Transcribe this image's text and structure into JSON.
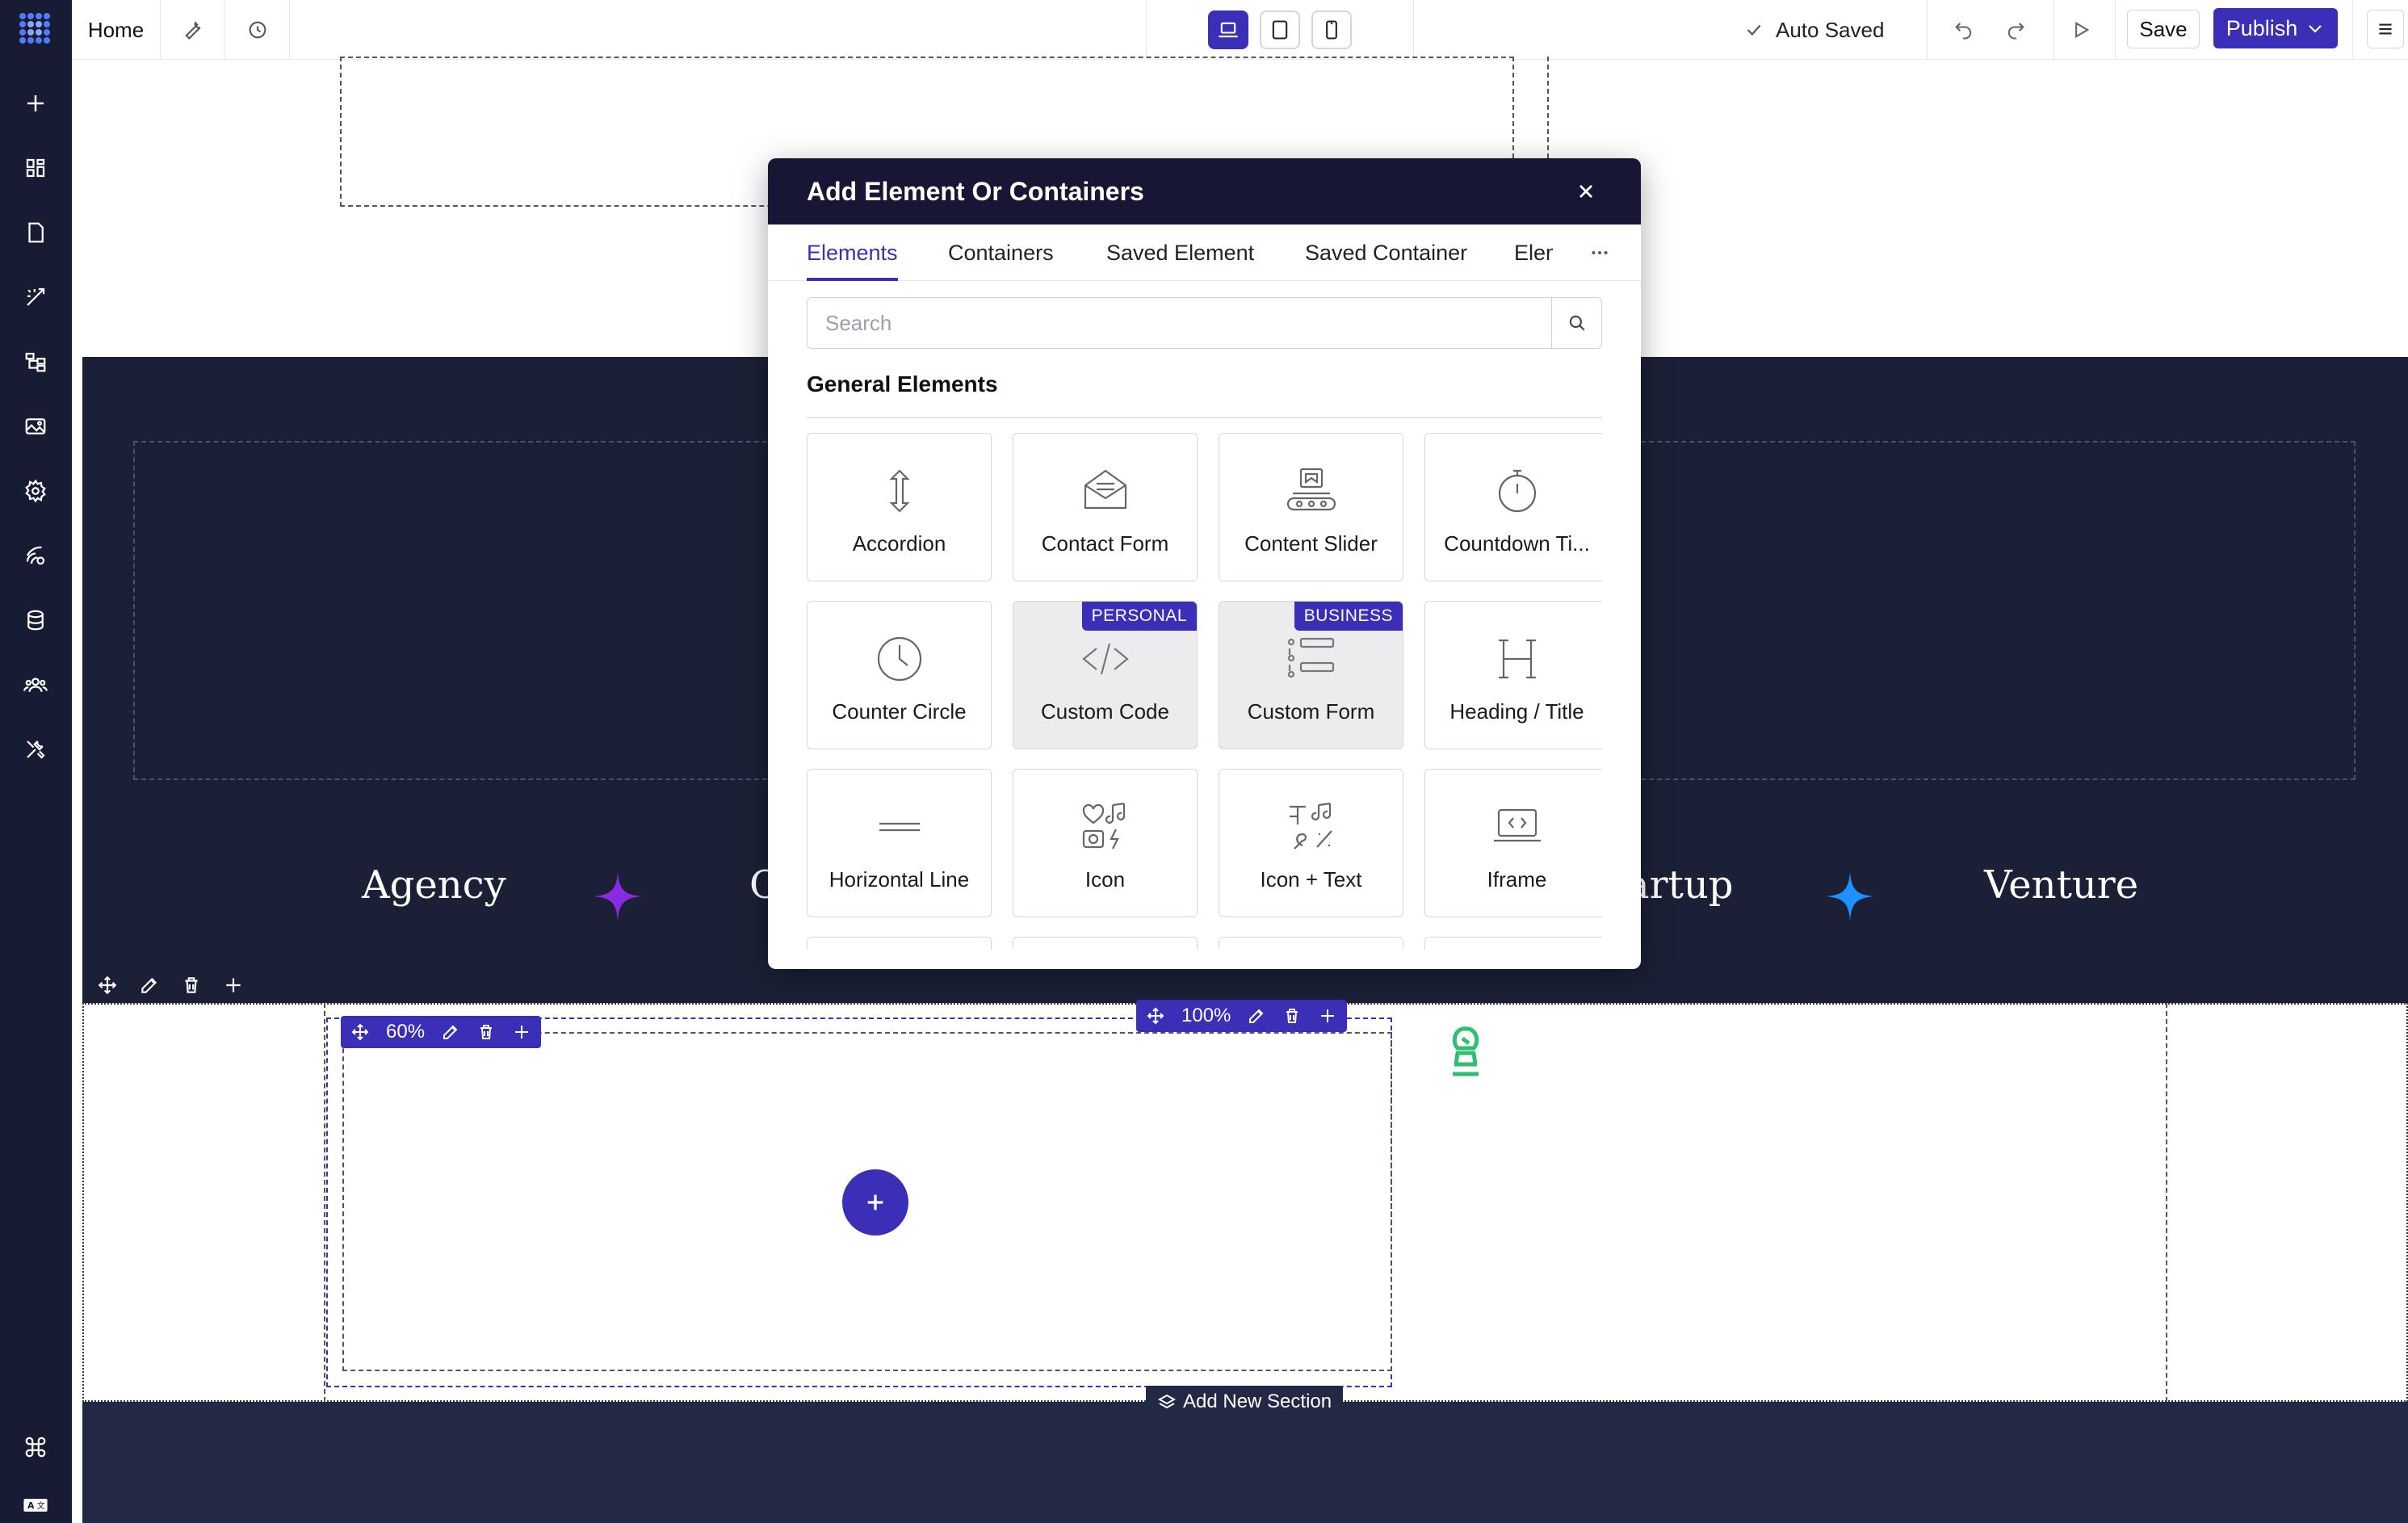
{
  "topbar": {
    "home_label": "Home",
    "autosave_label": "Auto Saved",
    "save_label": "Save",
    "publish_label": "Publish"
  },
  "sidebar": {
    "items": [
      "add-icon",
      "layout-grid-icon",
      "page-icon",
      "magic-icon",
      "structure-icon",
      "image-icon",
      "settings-icon",
      "integrations-icon",
      "database-icon",
      "users-icon",
      "tools-icon",
      "command-icon",
      "language-icon"
    ]
  },
  "canvas": {
    "marquee": [
      "Agency",
      "C",
      "artup",
      "Venture"
    ],
    "column_width": "60%",
    "row_width": "100%",
    "add_section_label": "Add New Section"
  },
  "modal": {
    "title": "Add Element Or Containers",
    "tabs": [
      "Elements",
      "Containers",
      "Saved Element",
      "Saved Container",
      "Eleme"
    ],
    "active_tab": "Elements",
    "search": {
      "placeholder": "Search",
      "value": ""
    },
    "group_title": "General Elements",
    "cards": [
      {
        "label": "Accordion",
        "icon": "accordion-icon"
      },
      {
        "label": "Contact Form",
        "icon": "envelope-icon"
      },
      {
        "label": "Content Slider",
        "icon": "slider-icon"
      },
      {
        "label": "Countdown Ti...",
        "icon": "stopwatch-icon"
      },
      {
        "label": "Counter Circle",
        "icon": "clock-icon"
      },
      {
        "label": "Custom Code",
        "icon": "code-icon",
        "badge": "PERSONAL"
      },
      {
        "label": "Custom Form",
        "icon": "form-icon",
        "badge": "BUSINESS"
      },
      {
        "label": "Heading / Title",
        "icon": "heading-icon"
      },
      {
        "label": "Horizontal Line",
        "icon": "line-icon"
      },
      {
        "label": "Icon",
        "icon": "icons-icon"
      },
      {
        "label": "Icon + Text",
        "icon": "icon-text-icon"
      },
      {
        "label": "Iframe",
        "icon": "iframe-icon"
      }
    ]
  },
  "colors": {
    "accent": "#3b2fb7",
    "sidebar": "#171b34",
    "dark_section": "#1b2036",
    "modal_header": "#171735",
    "sparkle_purple": "#8a2be2",
    "sparkle_blue": "#1e90ff",
    "chess_green": "#2fbf71"
  }
}
